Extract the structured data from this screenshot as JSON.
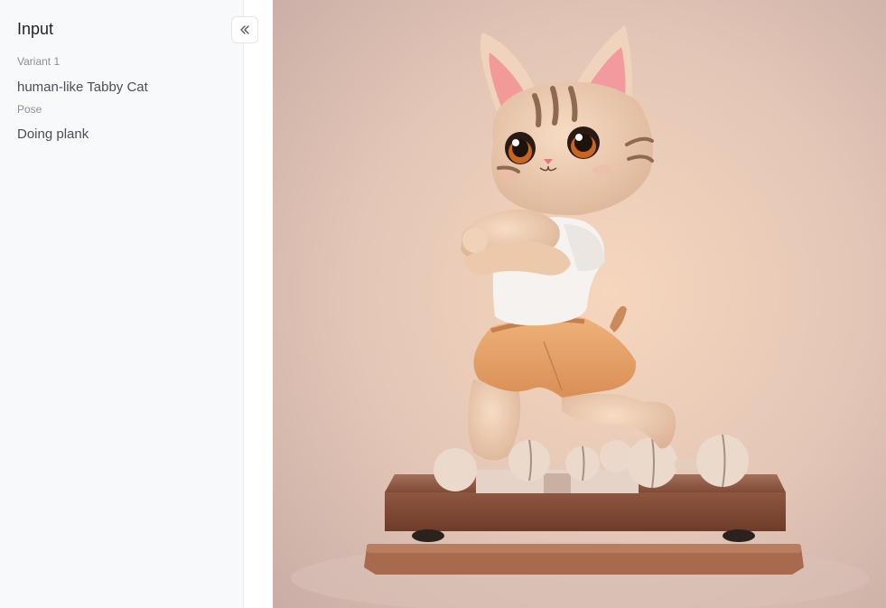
{
  "sidebar": {
    "title": "Input",
    "fields": [
      {
        "label": "Variant 1",
        "value": "human-like Tabby Cat"
      },
      {
        "label": "Pose",
        "value": "Doing plank"
      }
    ],
    "collapse_icon": "double-chevron-left-icon"
  },
  "image": {
    "subject": "3D rendered tabby cat figurine in white t-shirt and orange shorts standing on a wooden plinth"
  }
}
